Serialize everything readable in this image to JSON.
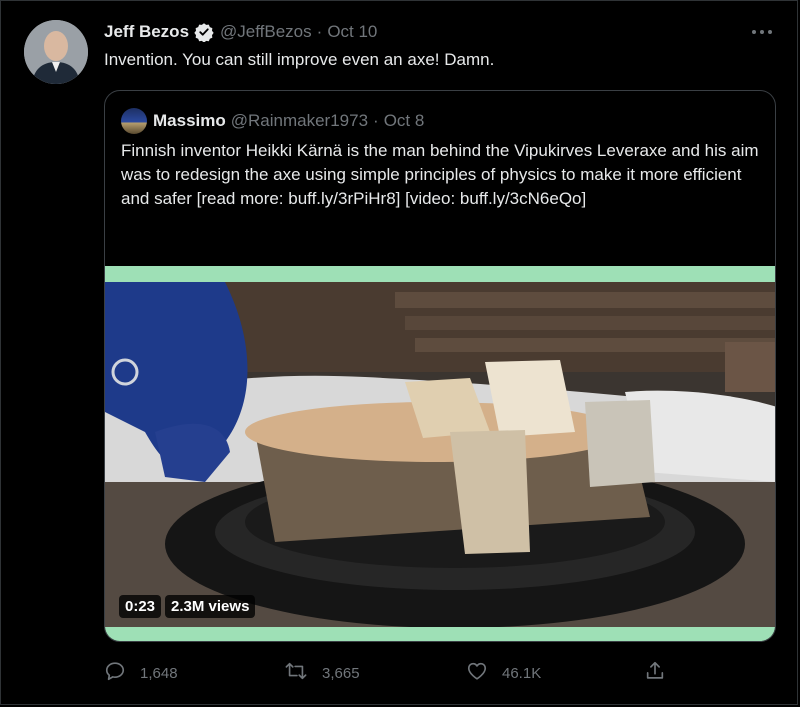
{
  "tweet": {
    "author_name": "Jeff Bezos",
    "handle": "@JeffBezos",
    "separator": "·",
    "date": "Oct 10",
    "text": "Invention. You can still improve even an axe! Damn.",
    "more_icon": "more-horizontal-icon"
  },
  "quoted": {
    "author_name": "Massimo",
    "handle": "@Rainmaker1973",
    "separator": "·",
    "date": "Oct 8",
    "text": "Finnish inventor Heikki Kärnä is the man behind the Vipukirves Leveraxe and his aim was to redesign the axe using simple principles of physics to make it more efficient and safer [read more: buff.ly/3rPiHr8] [video: buff.ly/3cN6eQo]",
    "video": {
      "duration": "0:23",
      "views": "2.3M views"
    }
  },
  "actions": {
    "reply": {
      "count": "1,648",
      "icon": "reply-icon"
    },
    "retweet": {
      "count": "3,665",
      "icon": "retweet-icon"
    },
    "like": {
      "count": "46.1K",
      "icon": "heart-icon"
    },
    "share": {
      "icon": "share-icon"
    }
  },
  "colors": {
    "background": "#000000",
    "text": "#e7e9ea",
    "muted": "#71767b",
    "verified": "#e7e9ea",
    "video_border": "#9ee0b6"
  }
}
